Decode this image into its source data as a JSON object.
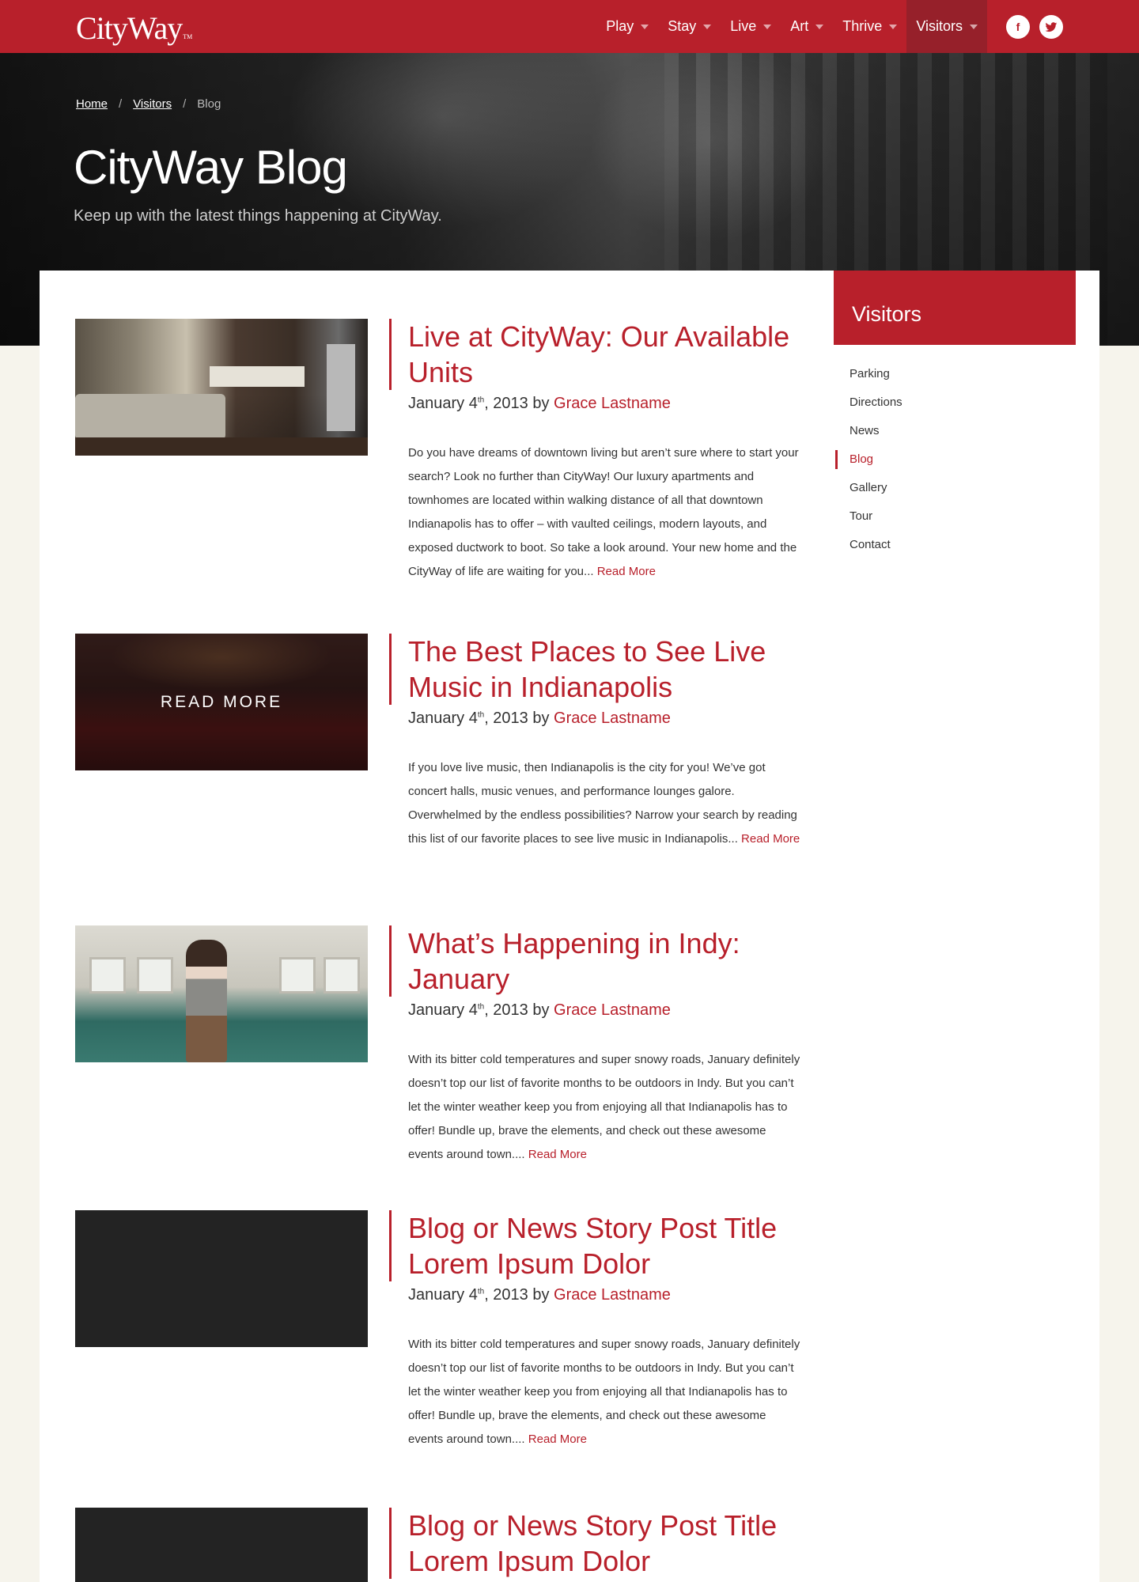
{
  "header": {
    "logo": "CityWay",
    "logo_tm": "TM",
    "nav": [
      {
        "label": "Play"
      },
      {
        "label": "Stay"
      },
      {
        "label": "Live"
      },
      {
        "label": "Art"
      },
      {
        "label": "Thrive"
      },
      {
        "label": "Visitors",
        "active": true
      }
    ],
    "social": {
      "facebook": "f",
      "twitter_icon": "twitter-bird-icon"
    }
  },
  "hero": {
    "breadcrumb": [
      "Home",
      "Visitors",
      "Blog"
    ],
    "breadcrumb_sep": "/",
    "title": "CityWay Blog",
    "subtitle": "Keep up with the latest things happening at CityWay."
  },
  "posts": [
    {
      "title": "Live at CityWay: Our Available Units",
      "date_pre": "January 4",
      "date_sup": "th",
      "date_post": ", 2013 by ",
      "author": "Grace Lastname",
      "excerpt": "Do you have dreams of downtown living but aren’t sure where to start your search? Look no further than CityWay! Our luxury apartments and townhomes are located within walking distance of all that downtown Indianapolis has to offer – with vaulted ceilings, modern layouts, and exposed ductwork to boot. So take a look around. Your new home and the CityWay of life are waiting for you...",
      "more": "Read More"
    },
    {
      "title": "The Best Places to See Live Music in Indianapolis",
      "date_pre": "January 4",
      "date_sup": "th",
      "date_post": ", 2013 by ",
      "author": "Grace Lastname",
      "excerpt": "If you love live music, then Indianapolis is the city for you! We’ve got concert halls, music venues, and performance lounges galore. Overwhelmed by the endless possibilities? Narrow your search by reading this list of our favorite places to see live music in Indianapolis...",
      "more": "Read More",
      "overlay": "READ MORE"
    },
    {
      "title": "What’s Happening in Indy: January",
      "date_pre": "January 4",
      "date_sup": "th",
      "date_post": ", 2013 by ",
      "author": "Grace Lastname",
      "excerpt": "With its bitter cold temperatures and super snowy roads, January definitely doesn’t top our list of favorite months to be outdoors in Indy. But you can’t let the winter weather keep you from enjoying all that Indianapolis has to offer! Bundle up, brave the elements, and check out these awesome events around town....",
      "more": "Read More"
    },
    {
      "title": "Blog or News Story Post Title Lorem Ipsum Dolor",
      "date_pre": "January 4",
      "date_sup": "th",
      "date_post": ", 2013 by ",
      "author": "Grace Lastname",
      "excerpt": "With its bitter cold temperatures and super snowy roads, January definitely doesn’t top our list of favorite months to be outdoors in Indy. But you can’t let the winter weather keep you from enjoying all that Indianapolis has to offer! Bundle up, brave the elements, and check out these awesome events around town....",
      "more": "Read More"
    },
    {
      "title": "Blog or News Story Post Title Lorem Ipsum Dolor"
    }
  ],
  "sidebar": {
    "heading": "Visitors",
    "items": [
      {
        "label": "Parking"
      },
      {
        "label": "Directions"
      },
      {
        "label": "News"
      },
      {
        "label": "Blog",
        "active": true
      },
      {
        "label": "Gallery"
      },
      {
        "label": "Tour"
      },
      {
        "label": "Contact"
      }
    ]
  },
  "colors": {
    "brand": "#b8202b",
    "brand_dark": "#96202a",
    "page_bg": "#f6f4ec"
  }
}
